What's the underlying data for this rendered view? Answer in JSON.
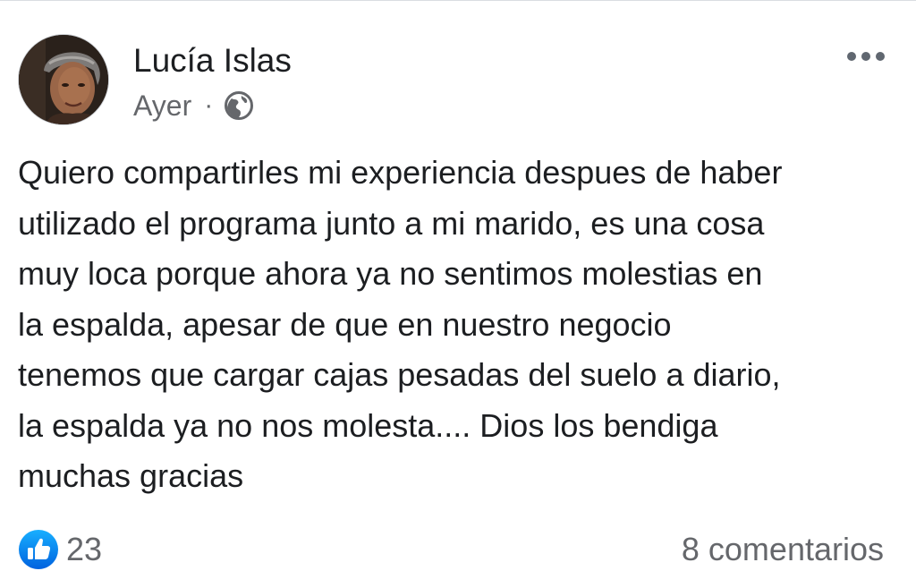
{
  "post": {
    "author": {
      "name": "Lucía Islas",
      "avatar_icon": "profile-photo"
    },
    "meta": {
      "timestamp": "Ayer",
      "separator": "·",
      "privacy_icon": "globe-icon"
    },
    "more_icon": "more-options-icon",
    "text": "Quiero compartirles mi experiencia despues de haber\nutilizado el programa junto a mi marido, es una cosa\nmuy loca porque ahora ya no sentimos molestias en\nla espalda, apesar de que en nuestro negocio\ntenemos que cargar cajas pesadas del suelo a diario,\nla espalda ya no nos molesta.... Dios los bendiga\nmuchas gracias",
    "reactions": {
      "icon": "like-icon",
      "count": "23"
    },
    "comments": {
      "label": "8 comentarios"
    }
  },
  "colors": {
    "text_primary": "#1c1e21",
    "text_secondary": "#65676b",
    "like_blue": "#1877f2",
    "divider": "#dadde1"
  }
}
